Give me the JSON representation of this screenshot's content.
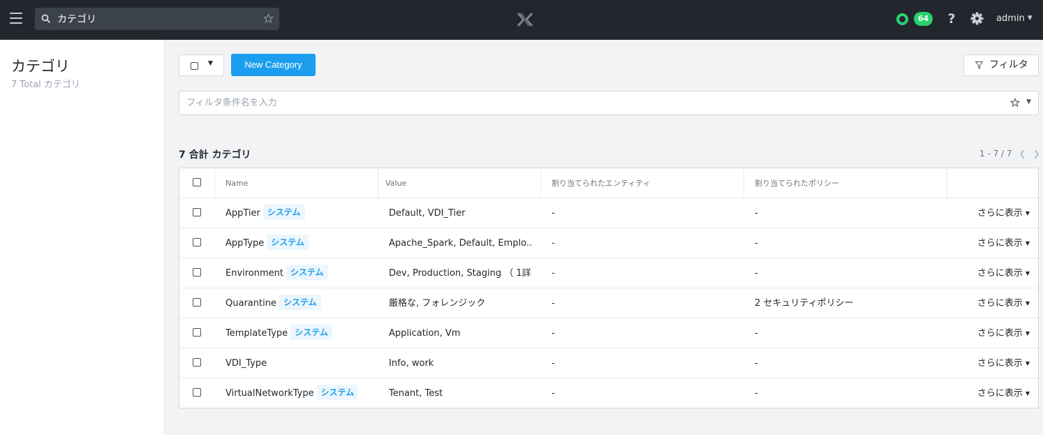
{
  "topbar": {
    "search_value": "カテゴリ",
    "alert_count": "64",
    "help_label": "?",
    "user": "admin",
    "colors": {
      "bg": "#22272e",
      "status_green": "#2ad070"
    }
  },
  "sidebar": {
    "title": "カテゴリ",
    "subtitle": "7 Total カテゴリ"
  },
  "toolbar": {
    "new_button": "New Category",
    "filter_button": "フィルタ",
    "filter_placeholder": "フィルタ条件名を入力",
    "accent_color": "#1b9eef"
  },
  "list": {
    "count_title": "7 合計 カテゴリ",
    "pagination": "1 - 7 / 7",
    "columns": [
      "Name",
      "Value",
      "割り当てられたエンティティ",
      "割り当てられたポリシー"
    ],
    "more_label": "さらに表示",
    "rows": [
      {
        "name": "AppTier",
        "tag": "システム",
        "value": "Default, VDI_Tier",
        "entities": "-",
        "policies": "-"
      },
      {
        "name": "AppType",
        "tag": "システム",
        "value": "Apache_Spark, Default, Emplo...",
        "entities": "-",
        "policies": "-"
      },
      {
        "name": "Environment",
        "tag": "システム",
        "value": "Dev, Production, Staging （ 1詳...",
        "entities": "-",
        "policies": "-"
      },
      {
        "name": "Quarantine",
        "tag": "システム",
        "value": "厳格な, フォレンジック",
        "entities": "-",
        "policies": "2 セキュリティポリシー"
      },
      {
        "name": "TemplateType",
        "tag": "システム",
        "value": "Application, Vm",
        "entities": "-",
        "policies": "-"
      },
      {
        "name": "VDI_Type",
        "tag": "",
        "value": "Info, work",
        "entities": "-",
        "policies": "-"
      },
      {
        "name": "VirtualNetworkType",
        "tag": "システム",
        "value": "Tenant, Test",
        "entities": "-",
        "policies": "-"
      }
    ]
  }
}
